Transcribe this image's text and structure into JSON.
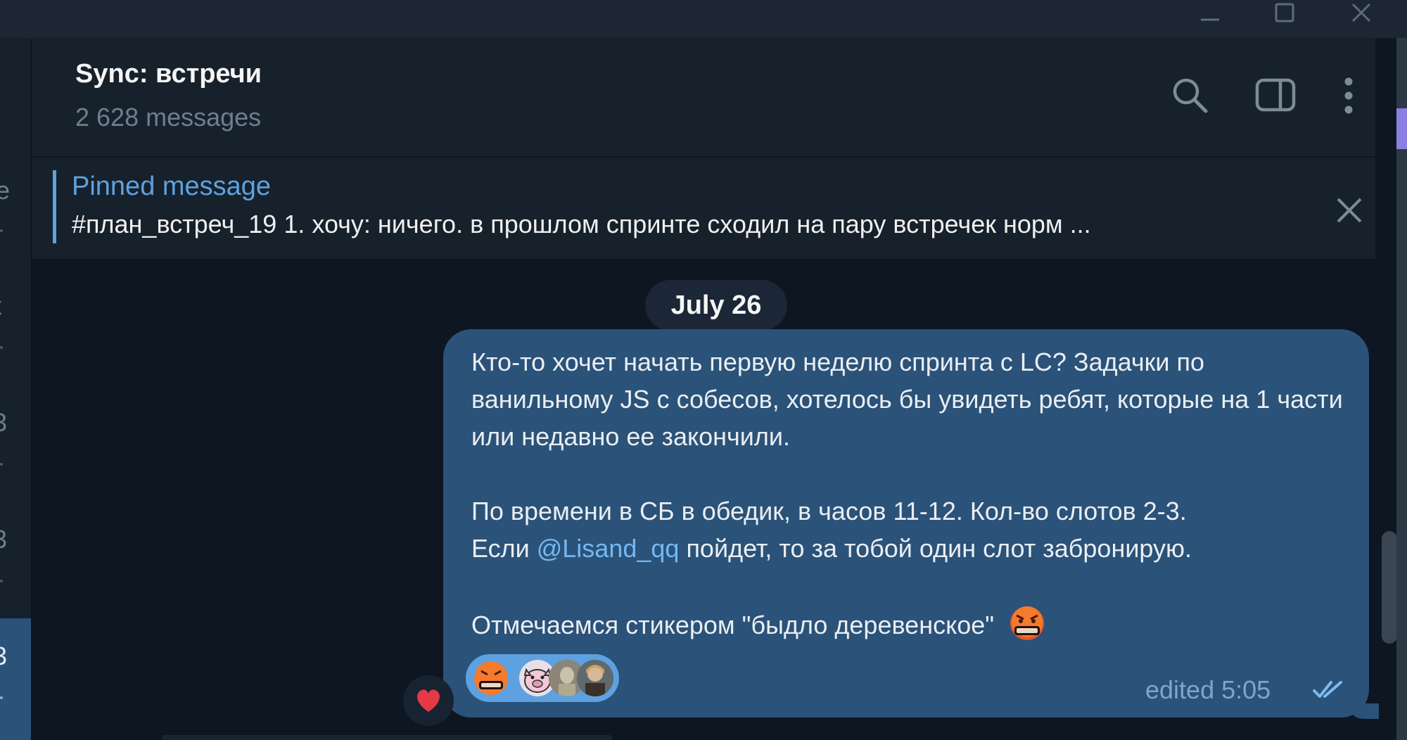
{
  "window": {
    "controls": [
      "minimize-icon",
      "maximize-icon",
      "close-icon"
    ]
  },
  "sidebar_fragments": [
    "e",
    "t",
    "3",
    "3",
    "3"
  ],
  "header": {
    "title": "Sync: встречи",
    "subtitle": "2 628 messages",
    "icons": [
      "search-icon",
      "sidebar-toggle-icon",
      "more-vertical-icon"
    ]
  },
  "pinned": {
    "label": "Pinned message",
    "text": "#план_встреч_19 1. хочу: ничего. в прошлом спринте сходил на пару встречек норм ..."
  },
  "chat": {
    "date": "July 26",
    "message": {
      "line1": "Кто-то хочет начать первую неделю спринта с LC? Задачки по ванильному JS с собесов, хотелось бы увидеть ребят, которые на 1 части или недавно ее закончили.",
      "line2a": "По времени в СБ в обедик, в часов 11-12. Кол-во слотов 2-3.",
      "line2b_pre": "Если ",
      "mention": "@Lisand_qq",
      "line2b_post": " пойдет, то за тобой один слот забронирую.",
      "line3": "Отмечаемся стикером \"быдло деревенское\"",
      "emoji": "angry-face-emoji",
      "status": "edited 5:05",
      "read_icon": "double-check-icon",
      "reactions": [
        "angry-face-emoji",
        "sticker-pig",
        "avatar-1",
        "avatar-2"
      ]
    },
    "quick_reaction": "heart-icon"
  },
  "colors": {
    "background": "#0e1621",
    "panel": "#17212b",
    "bubble": "#2b5278",
    "accent": "#5ea1e0",
    "mention": "#74b8f5",
    "muted": "#6d7f8f"
  }
}
